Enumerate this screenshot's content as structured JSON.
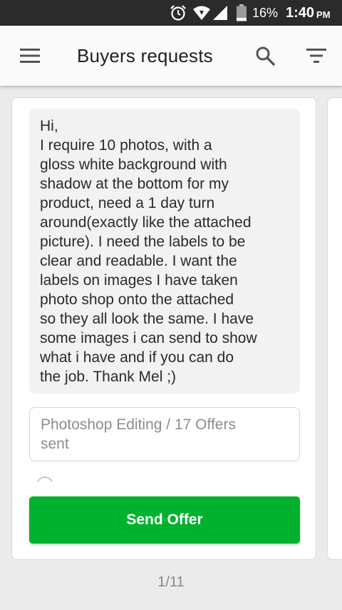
{
  "status_bar": {
    "battery_percent": "16%",
    "time": "1:40",
    "ampm": "PM",
    "icons": [
      "alarm-icon",
      "wifi-icon",
      "signal-icon",
      "battery-icon"
    ]
  },
  "app_bar": {
    "title": "Buyers requests",
    "icons": [
      "hamburger-menu-icon",
      "search-icon",
      "filter-icon"
    ]
  },
  "request": {
    "message_lines": [
      "Hi,",
      "I require 10 photos, with a",
      "gloss white background with",
      "shadow at the bottom for my",
      "product, need a 1 day turn",
      "around(exactly like the attached",
      "picture).  I need the labels to be",
      "clear and readable.  I want the",
      "labels on images I have taken",
      "photo shop onto the attached",
      "so they all look the same. I have",
      "some images i can send to show",
      "what i have and if you can do",
      "the job. Thank Mel ;)"
    ],
    "category_line1": "Photoshop Editing / 17 Offers",
    "category_line2": "sent",
    "send_button": "Send Offer"
  },
  "pager": "1/11",
  "colors": {
    "status_bar": "#2b2b2b",
    "accent_green": "#00b22d",
    "background": "#ebebeb"
  }
}
